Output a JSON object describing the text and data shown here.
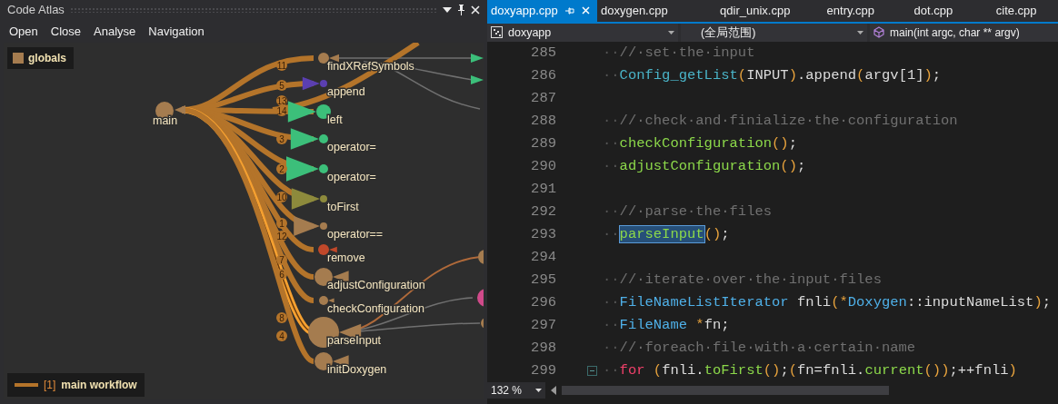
{
  "atlas": {
    "title": "Code Atlas",
    "menu": [
      "Open",
      "Close",
      "Analyse",
      "Navigation"
    ],
    "scope": {
      "label": "globals",
      "color": "#a57c4f"
    },
    "root": {
      "label": "main",
      "color": "#a57c4f"
    },
    "nodes": [
      {
        "label": "findXRefSymbols",
        "number": "11",
        "color": "#a57c4f",
        "kind": "call"
      },
      {
        "label": "append",
        "number": "5",
        "color": "#5b3fb0",
        "kind": "call"
      },
      {
        "label": "left",
        "number": "14",
        "color": "#3cbf7a",
        "kind": "call"
      },
      {
        "label": "operator=",
        "number": "3",
        "color": "#3cbf7a",
        "kind": "call"
      },
      {
        "label": "operator=",
        "number": "2",
        "color": "#3cbf7a",
        "kind": "call"
      },
      {
        "label": "toFirst",
        "number": "10",
        "color": "#8d8a3c",
        "kind": "call"
      },
      {
        "label": "operator==",
        "number": "1",
        "color": "#a57c4f",
        "kind": "call"
      },
      {
        "label": "remove",
        "number": "12",
        "color": "#c0482a",
        "kind": "call"
      },
      {
        "label": "adjustConfiguration",
        "number": "7",
        "color": "#a57c4f",
        "kind": "call"
      },
      {
        "label": "checkConfiguration",
        "number": "6",
        "color": "#a57c4f",
        "kind": "call"
      },
      {
        "label": "parseInput",
        "number": "8",
        "color": "#a57c4f",
        "kind": "workflow"
      },
      {
        "label": "initDoxygen",
        "number": "4",
        "color": "#a57c4f",
        "kind": "call"
      }
    ],
    "extra_number": "13",
    "workflow": {
      "index": "[1]",
      "name": "main workflow"
    }
  },
  "editor": {
    "tabs": [
      {
        "label": "doxyapp.cpp",
        "selected": true
      },
      {
        "label": "doxygen.cpp",
        "selected": false
      },
      {
        "label": "qdir_unix.cpp",
        "selected": false
      },
      {
        "label": "entry.cpp",
        "selected": false
      },
      {
        "label": "dot.cpp",
        "selected": false
      },
      {
        "label": "cite.cpp",
        "selected": false
      }
    ],
    "project": "doxyapp",
    "scope": "(全局范围)",
    "member": "main(int argc, char ** argv)",
    "lines": [
      {
        "number": "285",
        "kind": "code",
        "tokens": [
          {
            "kind": "ws",
            "text": "··"
          },
          {
            "kind": "comment",
            "text": "//·set·the·input"
          }
        ]
      },
      {
        "number": "286",
        "kind": "code",
        "tokens": [
          {
            "kind": "ws",
            "text": "··"
          },
          {
            "kind": "macro",
            "text": "Config_getList"
          },
          {
            "kind": "punct",
            "text": "("
          },
          {
            "kind": "plain",
            "text": "INPUT"
          },
          {
            "kind": "punct",
            "text": ")"
          },
          {
            "kind": "plain",
            "text": ".append"
          },
          {
            "kind": "punct",
            "text": "("
          },
          {
            "kind": "plain",
            "text": "argv[1]"
          },
          {
            "kind": "punct",
            "text": ")"
          },
          {
            "kind": "plain",
            "text": ";"
          }
        ]
      },
      {
        "number": "287",
        "kind": "code"
      },
      {
        "number": "288",
        "kind": "code",
        "tokens": [
          {
            "kind": "ws",
            "text": "··"
          },
          {
            "kind": "comment",
            "text": "//·check·and·finialize·the·configuration"
          }
        ]
      },
      {
        "number": "289",
        "kind": "code",
        "tokens": [
          {
            "kind": "ws",
            "text": "··"
          },
          {
            "kind": "func",
            "text": "checkConfiguration"
          },
          {
            "kind": "punct",
            "text": "()"
          },
          {
            "kind": "plain",
            "text": ";"
          }
        ]
      },
      {
        "number": "290",
        "kind": "code",
        "tokens": [
          {
            "kind": "ws",
            "text": "··"
          },
          {
            "kind": "func",
            "text": "adjustConfiguration"
          },
          {
            "kind": "punct",
            "text": "()"
          },
          {
            "kind": "plain",
            "text": ";"
          }
        ]
      },
      {
        "number": "291",
        "kind": "code"
      },
      {
        "number": "292",
        "kind": "code",
        "tokens": [
          {
            "kind": "ws",
            "text": "··"
          },
          {
            "kind": "comment",
            "text": "//·parse·the·files"
          }
        ]
      },
      {
        "number": "293",
        "kind": "code",
        "tokens": [
          {
            "kind": "ws",
            "text": "··"
          },
          {
            "kind": "highlight",
            "text": "parseInput"
          },
          {
            "kind": "punct",
            "text": "()"
          },
          {
            "kind": "plain",
            "text": ";"
          }
        ]
      },
      {
        "number": "294",
        "kind": "code"
      },
      {
        "number": "295",
        "kind": "code",
        "tokens": [
          {
            "kind": "ws",
            "text": "··"
          },
          {
            "kind": "comment",
            "text": "//·iterate·over·the·input·files"
          }
        ]
      },
      {
        "number": "296",
        "kind": "code",
        "tokens": [
          {
            "kind": "ws",
            "text": "··"
          },
          {
            "kind": "type",
            "text": "FileNameListIterator"
          },
          {
            "kind": "plain",
            "text": " fnli"
          },
          {
            "kind": "punct",
            "text": "(*"
          },
          {
            "kind": "type",
            "text": "Doxygen"
          },
          {
            "kind": "plain",
            "text": "::inputNameList"
          },
          {
            "kind": "punct",
            "text": ")"
          },
          {
            "kind": "plain",
            "text": ";"
          }
        ]
      },
      {
        "number": "297",
        "kind": "code",
        "tokens": [
          {
            "kind": "ws",
            "text": "··"
          },
          {
            "kind": "type",
            "text": "FileName"
          },
          {
            "kind": "punct",
            "text": " *"
          },
          {
            "kind": "plain",
            "text": "fn;"
          }
        ]
      },
      {
        "number": "298",
        "kind": "code",
        "tokens": [
          {
            "kind": "ws",
            "text": "··"
          },
          {
            "kind": "comment",
            "text": "//·foreach·file·with·a·certain·name"
          }
        ]
      },
      {
        "number": "299",
        "kind": "block-start",
        "tokens": [
          {
            "kind": "ws",
            "text": "··"
          },
          {
            "kind": "keyword",
            "text": "for"
          },
          {
            "kind": "punct",
            "text": " ("
          },
          {
            "kind": "plain",
            "text": "fnli."
          },
          {
            "kind": "func",
            "text": "toFirst"
          },
          {
            "kind": "punct",
            "text": "()"
          },
          {
            "kind": "plain",
            "text": ";"
          },
          {
            "kind": "punct",
            "text": "("
          },
          {
            "kind": "plain",
            "text": "fn=fnli."
          },
          {
            "kind": "func",
            "text": "current"
          },
          {
            "kind": "punct",
            "text": "())"
          },
          {
            "kind": "plain",
            "text": ";++fnli"
          },
          {
            "kind": "punct",
            "text": ")"
          }
        ]
      }
    ],
    "zoom": "132 %"
  }
}
